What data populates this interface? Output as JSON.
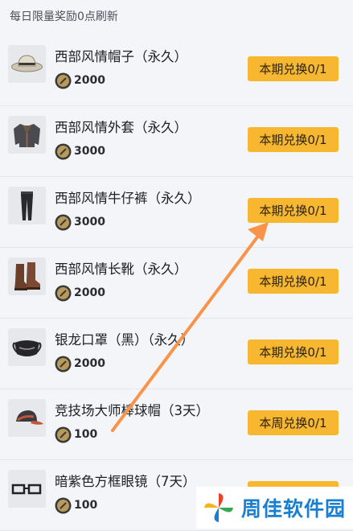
{
  "header": {
    "note": "每日限量奖励0点刷新"
  },
  "items": [
    {
      "name": "西部风情帽子（永久）",
      "price": "2000",
      "button": "本期兑换0/1",
      "icon": "hat-icon"
    },
    {
      "name": "西部风情外套（永久）",
      "price": "3000",
      "button": "本期兑换0/1",
      "icon": "jacket-icon"
    },
    {
      "name": "西部风情牛仔裤（永久）",
      "price": "3000",
      "button": "本期兑换0/1",
      "icon": "jeans-icon"
    },
    {
      "name": "西部风情长靴（永久）",
      "price": "2000",
      "button": "本期兑换0/1",
      "icon": "boots-icon"
    },
    {
      "name": "银龙口罩（黑）（永久）",
      "price": "2000",
      "button": "本期兑换0/1",
      "icon": "face-mask-icon"
    },
    {
      "name": "竞技场大师棒球帽（3天）",
      "price": "100",
      "button": "本周兑换0/1",
      "icon": "baseball-cap-icon"
    },
    {
      "name": "暗紫色方框眼镜（7天）",
      "price": "100",
      "button": "",
      "icon": "glasses-icon"
    }
  ],
  "watermark": {
    "text": "周佳软件园",
    "icon": "pinwheel-logo-icon"
  },
  "colors": {
    "button": "#f8b731",
    "arrow": "#f7944a",
    "watermark_text": "#1a7fd1"
  }
}
